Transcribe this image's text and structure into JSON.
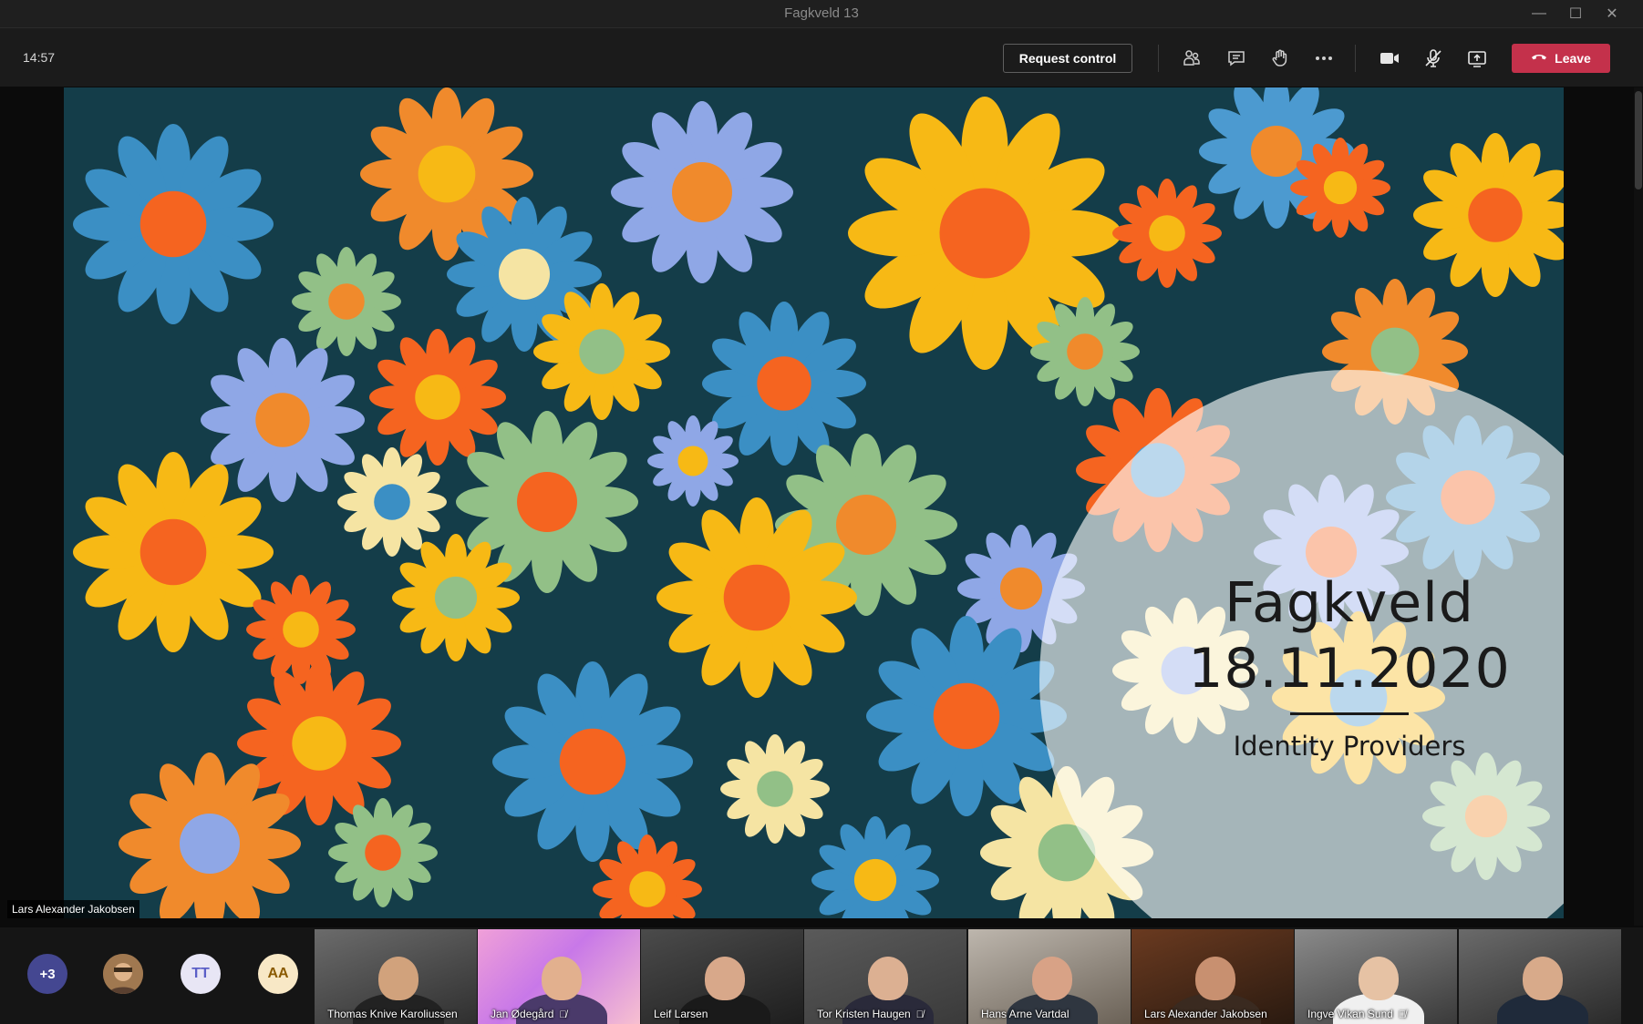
{
  "window": {
    "title": "Fagkveld 13",
    "minimize_glyph": "—",
    "maximize_glyph": "☐",
    "close_glyph": "✕"
  },
  "toolbar": {
    "time": "14:57",
    "request_control_label": "Request control",
    "icons": [
      "participants-icon",
      "chat-icon",
      "raise-hand-icon",
      "more-options-icon",
      "camera-icon",
      "mic-muted-icon",
      "share-tray-icon"
    ],
    "leave_label": "Leave",
    "leave_color": "#c4314b"
  },
  "slide": {
    "title": "Fagkveld",
    "date": "18.11.2020",
    "subtitle": "Identity Providers",
    "presenter": "Lars Alexander Jakobsen"
  },
  "participants": {
    "overflow_count": "+3",
    "initials": [
      {
        "text": "TT",
        "bg": "#e8e6f5",
        "fg": "#5b5fc7"
      },
      {
        "text": "AA",
        "bg": "#f8e8c6",
        "fg": "#8a5a00"
      }
    ],
    "tiles": [
      {
        "name": "Thomas Knive Karoliussen",
        "muted": false
      },
      {
        "name": "Jan Ødegård",
        "muted": true
      },
      {
        "name": "Leif Larsen",
        "muted": false
      },
      {
        "name": "Tor Kristen Haugen",
        "muted": true
      },
      {
        "name": "Hans Arne Vartdal",
        "muted": false
      },
      {
        "name": "Lars Alexander Jakobsen",
        "muted": false
      },
      {
        "name": "Ingve Vikan Sund",
        "muted": true
      },
      {
        "name": "",
        "muted": false
      }
    ]
  }
}
